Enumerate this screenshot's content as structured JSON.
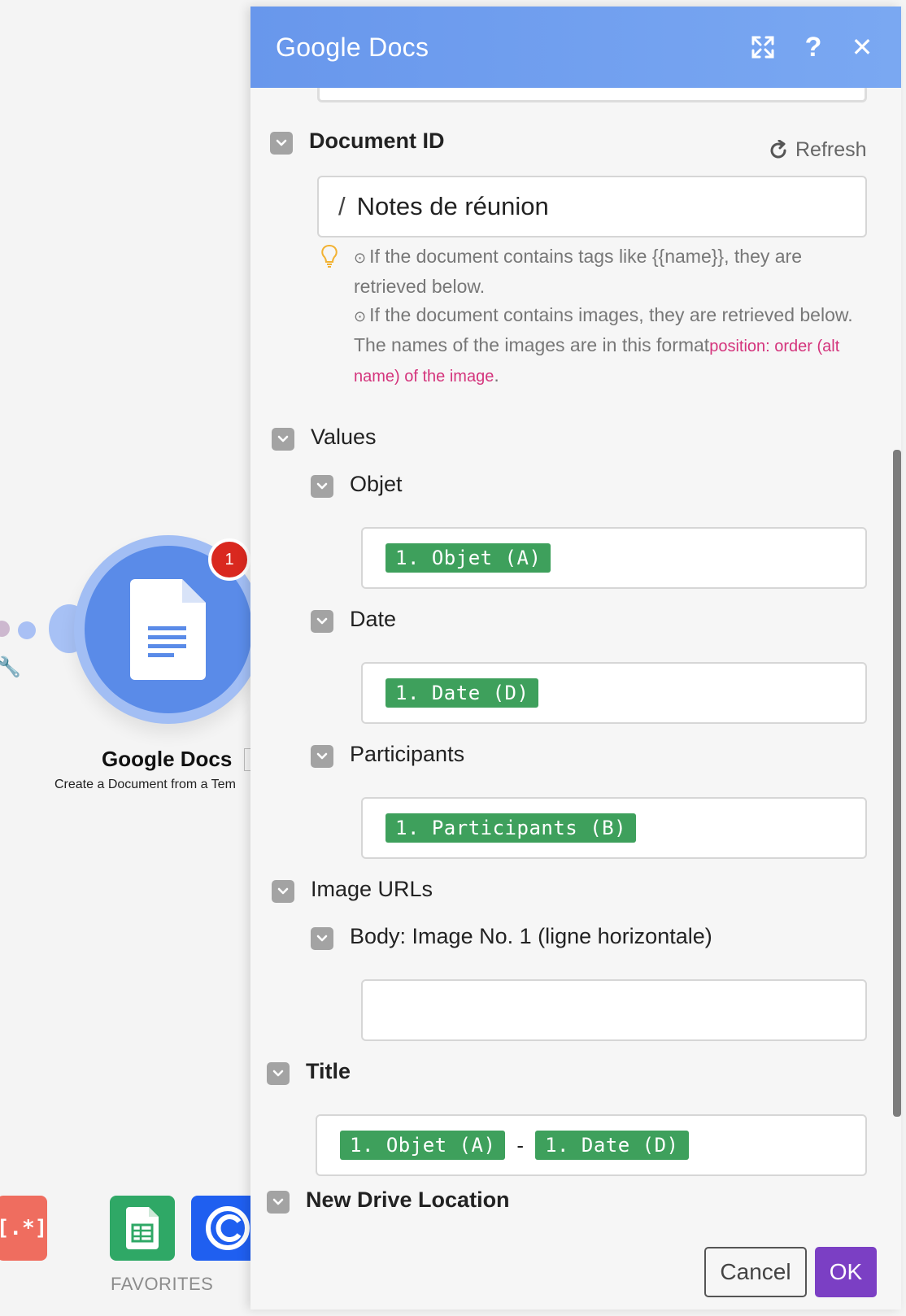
{
  "canvas": {
    "module": {
      "title": "Google Docs",
      "subtitle": "Create a Document from a Tem",
      "badge_count": "1"
    },
    "favorites_label": "FAVORITES",
    "tiles": [
      {
        "name": "json-module-tile",
        "glyph": "[.*]"
      },
      {
        "name": "google-sheets-tile"
      },
      {
        "name": "make-tile"
      }
    ]
  },
  "panel": {
    "title": "Google Docs",
    "colors": {
      "header": "#6897ec",
      "pill": "#3ea05c",
      "ok": "#7b3fc4",
      "highlight": "#d4347c"
    },
    "document_id": {
      "label": "Document ID",
      "refresh_label": "Refresh",
      "slash": "/",
      "value": "Notes de réunion",
      "hint_line1": "If the document contains tags like {{name}}, they are retrieved below.",
      "hint_line2": "If the document contains images, they are retrieved below. The names of the images are in this format",
      "hint_highlight": "position: order (alt name) of the image",
      "hint_end": "."
    },
    "values": {
      "label": "Values",
      "fields": [
        {
          "label": "Objet",
          "pills": [
            "1. Objet (A)"
          ]
        },
        {
          "label": "Date",
          "pills": [
            "1. Date (D)"
          ]
        },
        {
          "label": "Participants",
          "pills": [
            "1. Participants (B)"
          ]
        }
      ]
    },
    "image_urls": {
      "label": "Image URLs",
      "field_label": "Body: Image No. 1 (ligne horizontale)",
      "value": ""
    },
    "title_field": {
      "label": "Title",
      "pill1": "1. Objet (A)",
      "separator": "-",
      "pill2": "1. Date (D)"
    },
    "new_drive_location": {
      "label": "New Drive Location"
    },
    "footer": {
      "cancel_label": "Cancel",
      "ok_label": "OK"
    }
  }
}
